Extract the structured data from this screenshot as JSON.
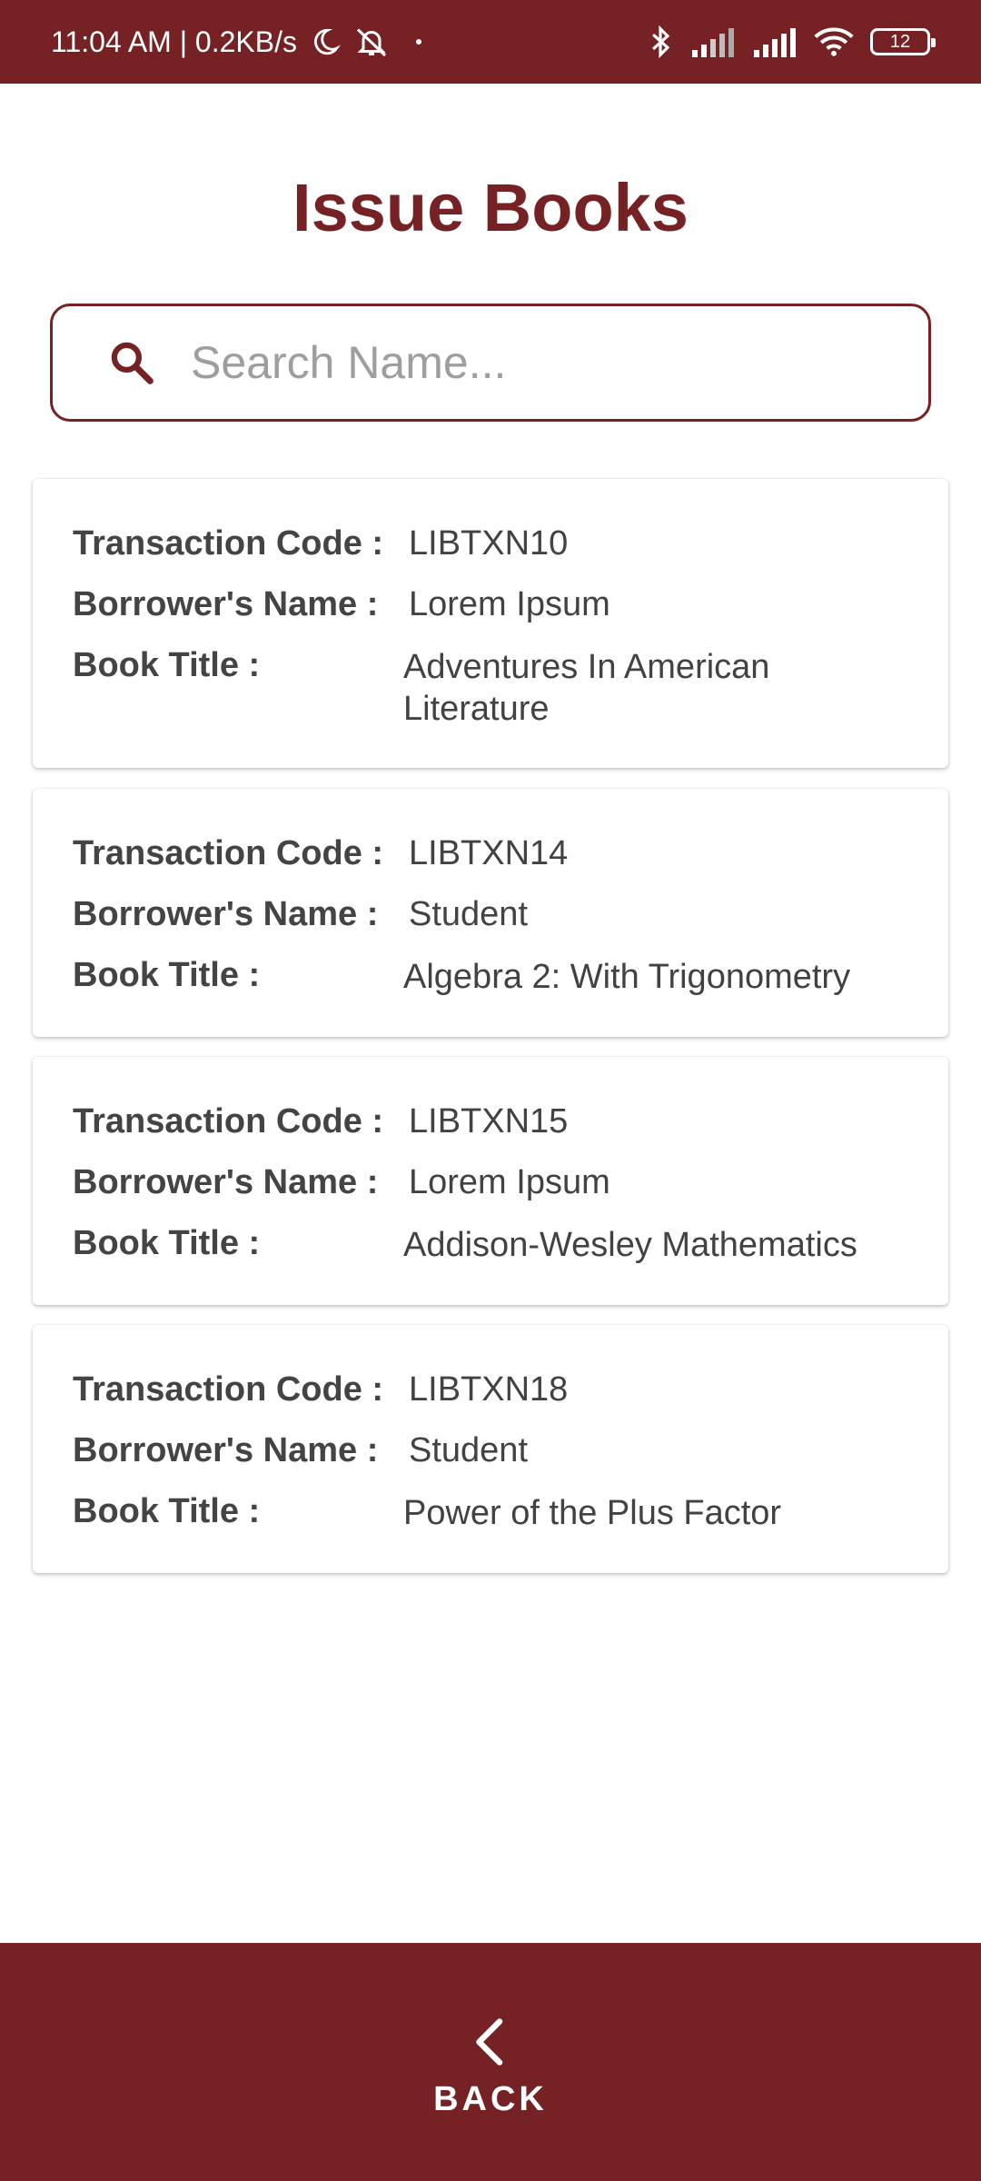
{
  "status_bar": {
    "time_speed": "11:04 AM | 0.2KB/s",
    "battery_level": "12",
    "icons": [
      "moon-icon",
      "alarm-off-icon",
      "dot-icon",
      "bluetooth-icon",
      "signal-icon",
      "signal-icon",
      "wifi-icon",
      "battery-icon"
    ]
  },
  "header": {
    "title": "Issue Books"
  },
  "search": {
    "placeholder": "Search Name...",
    "value": ""
  },
  "labels": {
    "transaction_code": "Transaction Code :",
    "borrower_name": "Borrower's Name :",
    "book_title": "Book Title :"
  },
  "transactions": [
    {
      "code": "LIBTXN10",
      "borrower": "Lorem Ipsum",
      "title": "Adventures In American Literature"
    },
    {
      "code": "LIBTXN14",
      "borrower": "Student",
      "title": "Algebra 2: With Trigonometry"
    },
    {
      "code": "LIBTXN15",
      "borrower": "Lorem Ipsum",
      "title": "Addison-Wesley Mathematics"
    },
    {
      "code": "LIBTXN18",
      "borrower": "Student",
      "title": "Power of the Plus Factor"
    }
  ],
  "footer": {
    "back_label": "BACK"
  },
  "colors": {
    "brand": "#762224",
    "text": "#424242",
    "placeholder": "#9e9e9e"
  }
}
